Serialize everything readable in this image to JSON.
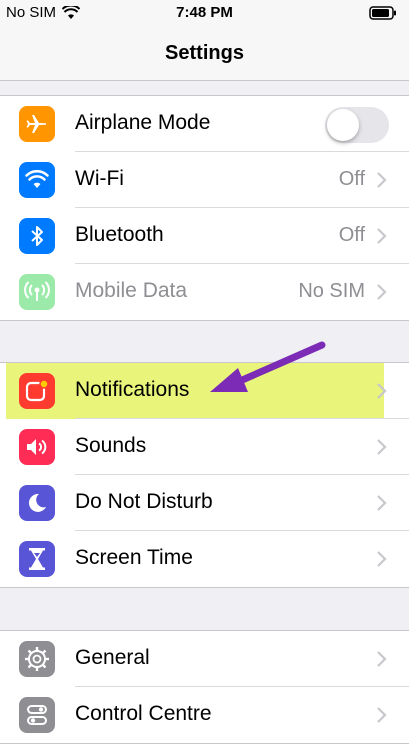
{
  "status_bar": {
    "carrier": "No SIM",
    "time": "7:48 PM"
  },
  "nav": {
    "title": "Settings"
  },
  "groups": {
    "connectivity": [
      {
        "label": "Airplane Mode",
        "icon": "airplane-icon",
        "toggle_on": false,
        "icon_color": "#ff9500"
      },
      {
        "label": "Wi-Fi",
        "value": "Off",
        "icon": "wifi-icon",
        "icon_color": "#007aff"
      },
      {
        "label": "Bluetooth",
        "value": "Off",
        "icon": "bluetooth-icon",
        "icon_color": "#007aff"
      },
      {
        "label": "Mobile Data",
        "value": "No SIM",
        "icon": "antenna-icon",
        "icon_color": "#4cd964",
        "disabled": true
      }
    ],
    "notifications": [
      {
        "label": "Notifications",
        "icon": "notifications-icon",
        "icon_color": "#ff3b30",
        "highlighted": true
      },
      {
        "label": "Sounds",
        "icon": "speaker-icon",
        "icon_color": "#ff2d55"
      },
      {
        "label": "Do Not Disturb",
        "icon": "moon-icon",
        "icon_color": "#5856d6"
      },
      {
        "label": "Screen Time",
        "icon": "hourglass-icon",
        "icon_color": "#5856d6"
      }
    ],
    "system": [
      {
        "label": "General",
        "icon": "gear-icon",
        "icon_color": "#8e8e93"
      },
      {
        "label": "Control Centre",
        "icon": "toggles-icon",
        "icon_color": "#8e8e93"
      }
    ]
  },
  "annotation": {
    "arrow_color": "#7b2bb5",
    "highlight_color": "#e8f57a"
  }
}
